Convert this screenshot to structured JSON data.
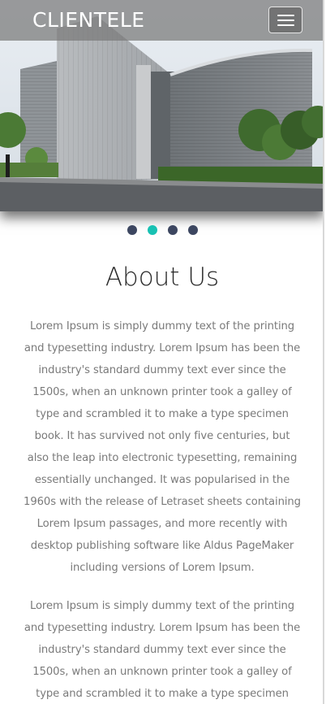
{
  "header": {
    "brand": "CLIENTELE",
    "menu_toggle_icon": "hamburger-icon"
  },
  "carousel": {
    "slides": 4,
    "active_index": 1,
    "image_subject": "modern building with curved facade"
  },
  "colors": {
    "dot": "#3c4660",
    "dot_active": "#18c1b3",
    "title": "#2b2b2b",
    "body_text": "#7a7a7a"
  },
  "about": {
    "title": "About Us",
    "paragraphs": [
      "Lorem Ipsum is simply dummy text of the printing and typesetting industry. Lorem Ipsum has been the industry's standard dummy text ever since the 1500s, when an unknown printer took a galley of type and scrambled it to make a type specimen book. It has survived not only five centuries, but also the leap into electronic typesetting, remaining essentially unchanged. It was popularised in the 1960s with the release of Letraset sheets containing Lorem Ipsum passages, and more recently with desktop publishing software like Aldus PageMaker including versions of Lorem Ipsum.",
      "Lorem Ipsum is simply dummy text of the printing and typesetting industry. Lorem Ipsum has been the industry's standard dummy text ever since the 1500s, when an unknown printer took a galley of type and scrambled it to make a type specimen"
    ]
  }
}
